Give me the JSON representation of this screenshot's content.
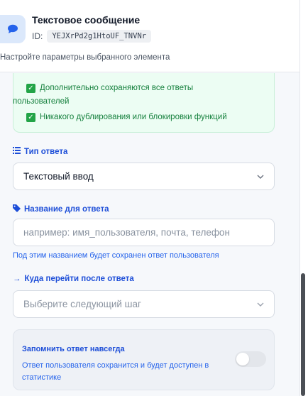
{
  "header": {
    "title": "Текстовое сообщение",
    "id_label": "ID:",
    "id_value": "YEJXrPd2g1HtoUF_TNVNr",
    "subtitle": "Настройте параметры выбранного элемента",
    "icon": "chat-bubble-icon"
  },
  "info": {
    "items": [
      "Дополнительно сохраняются все ответы",
      "пользователей",
      "Никакого дублирования или блокировки функций"
    ]
  },
  "answer_type": {
    "label": "Тип ответа",
    "icon": "list-icon",
    "value": "Текстовый ввод"
  },
  "answer_name": {
    "label": "Название для ответа",
    "icon": "tag-icon",
    "placeholder": "например: имя_пользователя, почта, телефон",
    "hint": "Под этим названием будет сохранен ответ пользователя"
  },
  "next_step": {
    "label": "Куда перейти после ответа",
    "arrow": "→",
    "placeholder": "Выберите следующий шаг"
  },
  "remember": {
    "title": "Запомнить ответ навсегда",
    "description": "Ответ пользователя сохранится и будет доступен в статистике",
    "enabled": false
  },
  "colors": {
    "accent": "#2563eb",
    "success": "#22a447",
    "success_bg": "#ecfdf3"
  }
}
